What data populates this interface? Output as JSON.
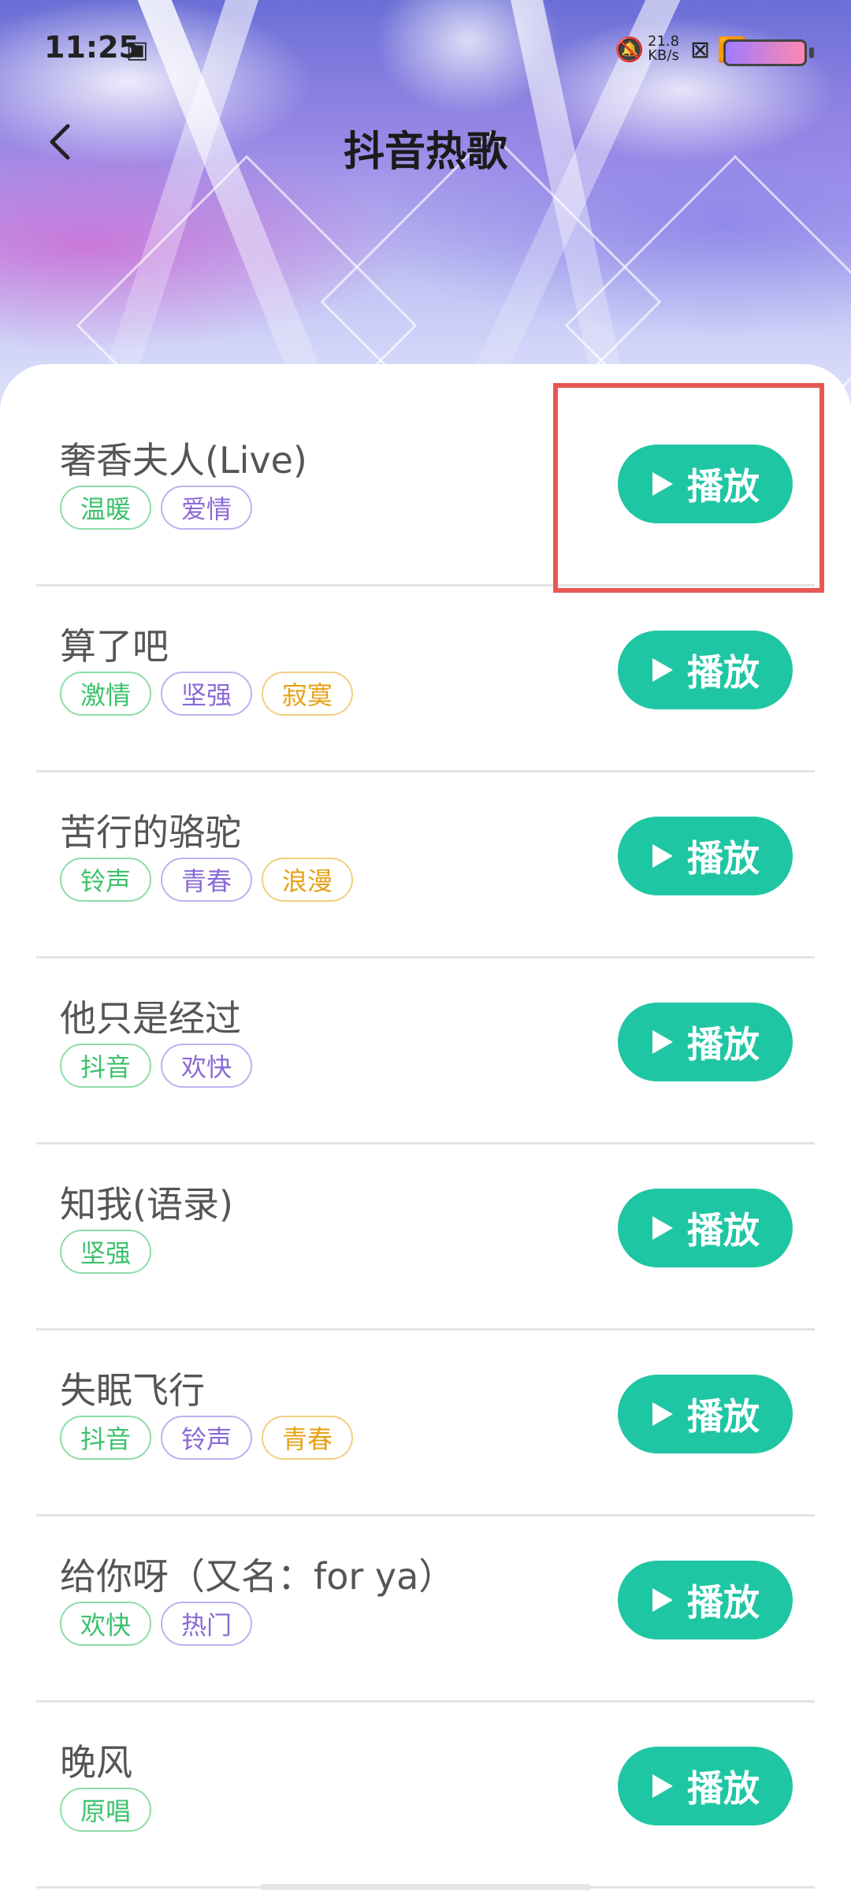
{
  "status": {
    "time": "11:25",
    "speed_top": "21.8",
    "speed_unit": "KB/s",
    "icons": [
      "sim-icon",
      "mute-icon",
      "wifi-icon",
      "x-icon",
      "battery-icon"
    ]
  },
  "header": {
    "title": "抖音热歌",
    "back_icon": "chevron-left-icon"
  },
  "songs": [
    {
      "name": "奢香夫人(Live)",
      "tags": [
        "温暖",
        "爱情"
      ],
      "play": "播放"
    },
    {
      "name": "算了吧",
      "tags": [
        "激情",
        "坚强",
        "寂寞"
      ],
      "play": "播放"
    },
    {
      "name": "苦行的骆驼",
      "tags": [
        "铃声",
        "青春",
        "浪漫"
      ],
      "play": "播放"
    },
    {
      "name": "他只是经过",
      "tags": [
        "抖音",
        "欢快"
      ],
      "play": "播放"
    },
    {
      "name": "知我(语录)",
      "tags": [
        "坚强"
      ],
      "play": "播放"
    },
    {
      "name": "失眠飞行",
      "tags": [
        "抖音",
        "铃声",
        "青春"
      ],
      "play": "播放"
    },
    {
      "name": "给你呀（又名：for ya）",
      "tags": [
        "欢快",
        "热门"
      ],
      "play": "播放"
    },
    {
      "name": "晚风",
      "tags": [
        "原唱"
      ],
      "play": "播放"
    }
  ],
  "colors": {
    "accent": "#1fc6a3",
    "tag_green": "#3cc26b",
    "tag_purple": "#8a6ad6",
    "tag_orange": "#e6a116",
    "highlight": "#e85853"
  }
}
